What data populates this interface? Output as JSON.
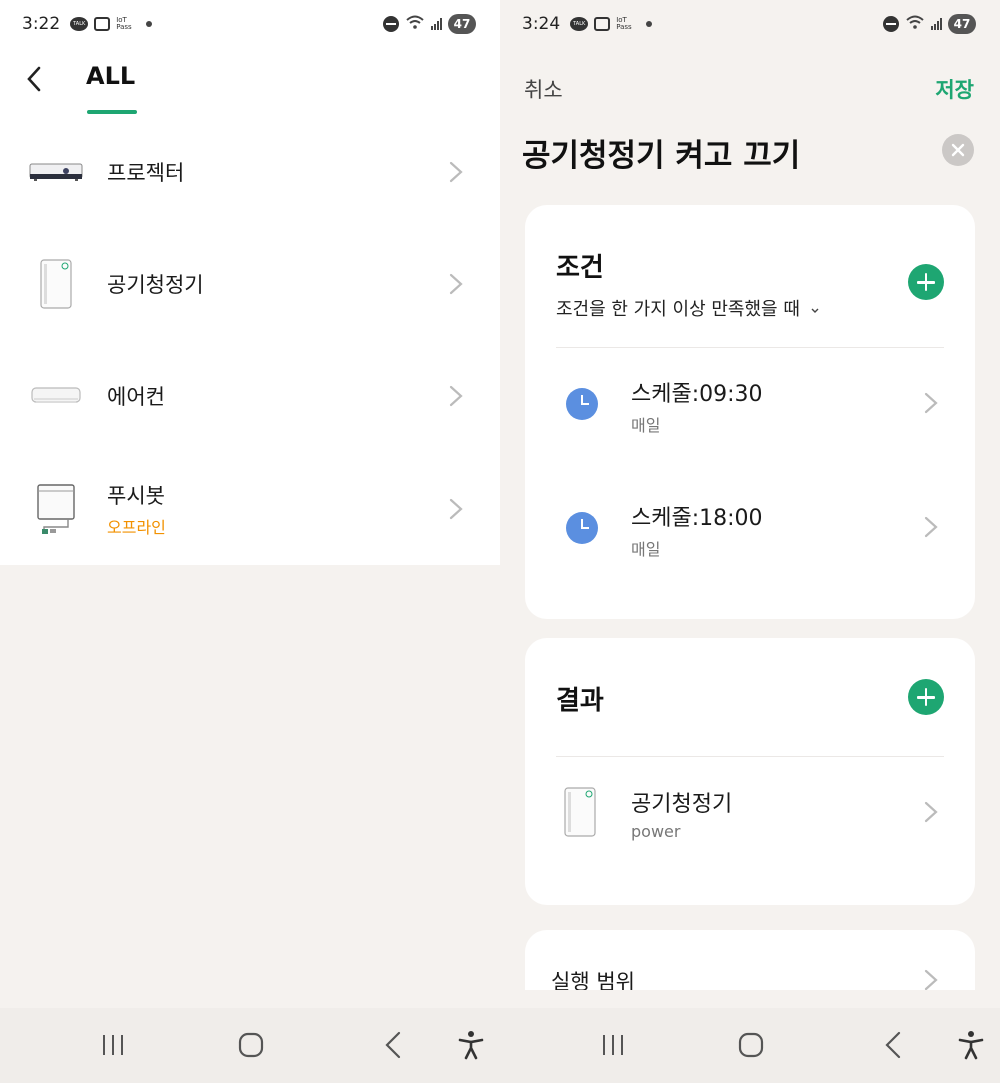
{
  "left_screen": {
    "status_bar": {
      "time": "3:22",
      "talk_label": "TALK",
      "iot_label": "IoT\nPass",
      "battery": "47"
    },
    "header": {
      "tab_label": "ALL"
    },
    "devices": [
      {
        "name": "프로젝터",
        "status": ""
      },
      {
        "name": "공기청정기",
        "status": ""
      },
      {
        "name": "에어컨",
        "status": ""
      },
      {
        "name": "푸시봇",
        "status": "오프라인"
      }
    ]
  },
  "right_screen": {
    "status_bar": {
      "time": "3:24",
      "talk_label": "TALK",
      "iot_label": "IoT\nPass",
      "battery": "47"
    },
    "toolbar": {
      "cancel_label": "취소",
      "save_label": "저장"
    },
    "routine_title": "공기청정기 켜고 끄기",
    "conditions_card": {
      "title": "조건",
      "match_mode": "조건을 한 가지 이상 만족했을 때",
      "items": [
        {
          "title": "스케줄:09:30",
          "subtitle": "매일"
        },
        {
          "title": "스케줄:18:00",
          "subtitle": "매일"
        }
      ]
    },
    "results_card": {
      "title": "결과",
      "items": [
        {
          "title": "공기청정기",
          "subtitle": "power"
        }
      ]
    },
    "scope_card": {
      "title": "실행 범위"
    }
  },
  "colors": {
    "accent_green": "#1ea672",
    "offline_orange": "#f29100",
    "clock_blue": "#5b8fe0",
    "background": "#f5f2ef"
  },
  "icons": {
    "left_devices": [
      "projector-icon",
      "air-purifier-icon",
      "air-conditioner-icon",
      "pushbot-icon"
    ],
    "navigation": [
      "recent-apps-icon",
      "home-icon",
      "back-icon",
      "accessibility-icon"
    ]
  }
}
